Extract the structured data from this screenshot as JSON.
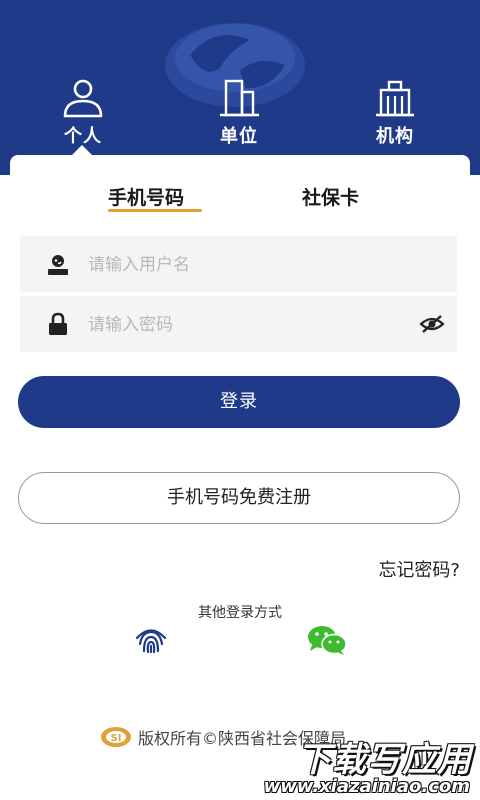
{
  "header": {
    "tabs": [
      {
        "label": "个人",
        "icon": "person-icon"
      },
      {
        "label": "单位",
        "icon": "building-icon"
      },
      {
        "label": "机构",
        "icon": "institution-icon"
      }
    ],
    "selected_tab": "个人"
  },
  "login_methods": {
    "phone": "手机号码",
    "card": "社保卡",
    "selected": "手机号码"
  },
  "form": {
    "username_placeholder": "请输入用户名",
    "password_placeholder": "请输入密码",
    "login_label": "登录",
    "register_label": "手机号码免费注册",
    "forgot_label": "忘记密码?"
  },
  "other_login": {
    "title": "其他登录方式",
    "options": [
      "fingerprint-icon",
      "wechat-icon"
    ]
  },
  "footer": {
    "copyright": "版权所有©陕西省社会保障局"
  },
  "watermark": {
    "main": "下载写应用",
    "sub": "www.xiazainiao.com"
  },
  "colors": {
    "primary": "#1f3a88",
    "accent_underline": "#e0a13a",
    "wechat": "#3ebb2e"
  }
}
